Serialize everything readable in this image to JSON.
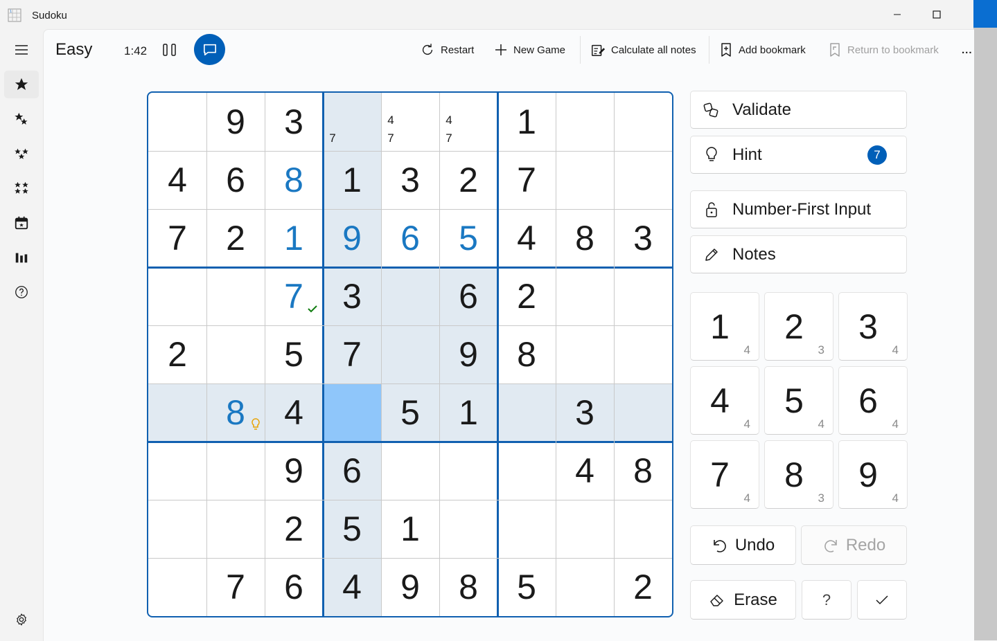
{
  "window": {
    "title": "Sudoku"
  },
  "header": {
    "difficulty": "Easy",
    "timer": "1:42"
  },
  "toolbar": {
    "restart": "Restart",
    "new_game": "New Game",
    "calculate_notes": "Calculate all notes",
    "add_bookmark": "Add bookmark",
    "return_bookmark": "Return to bookmark",
    "more": "..."
  },
  "nav": {
    "items": [
      "menu-icon",
      "star-icon",
      "two-stars-icon",
      "three-stars-icon",
      "four-stars-icon",
      "calendar-icon",
      "chart-icon",
      "help-icon"
    ],
    "settings": "gear-icon"
  },
  "board": {
    "cells": [
      [
        "",
        "9",
        "3",
        "",
        "",
        "",
        "1",
        "",
        ""
      ],
      [
        "4",
        "6",
        "8",
        "1",
        "3",
        "2",
        "7",
        "",
        ""
      ],
      [
        "7",
        "2",
        "1",
        "9",
        "6",
        "5",
        "4",
        "8",
        "3"
      ],
      [
        "",
        "",
        "7",
        "3",
        "",
        "6",
        "2",
        "",
        ""
      ],
      [
        "2",
        "",
        "5",
        "7",
        "",
        "9",
        "8",
        "",
        ""
      ],
      [
        "",
        "8",
        "4",
        "",
        "5",
        "1",
        "",
        "3",
        ""
      ],
      [
        "",
        "",
        "9",
        "6",
        "",
        "",
        "",
        "4",
        "8"
      ],
      [
        "",
        "",
        "2",
        "5",
        "1",
        "",
        "",
        "",
        ""
      ],
      [
        "",
        "7",
        "6",
        "4",
        "9",
        "8",
        "5",
        "",
        "2"
      ]
    ],
    "user_entries": [
      [
        1,
        2
      ],
      [
        2,
        2
      ],
      [
        2,
        3
      ],
      [
        2,
        4
      ],
      [
        2,
        5
      ],
      [
        3,
        2
      ],
      [
        5,
        1
      ]
    ],
    "notes": [
      {
        "row": 0,
        "col": 3,
        "values": [
          "7"
        ]
      },
      {
        "row": 0,
        "col": 4,
        "values": [
          "4",
          "7"
        ]
      },
      {
        "row": 0,
        "col": 5,
        "values": [
          "4",
          "7"
        ]
      }
    ],
    "selected": [
      5,
      3
    ],
    "checked_cell": [
      3,
      2
    ],
    "hint_cell": [
      5,
      1
    ]
  },
  "panel": {
    "validate": "Validate",
    "hint": "Hint",
    "hint_count": "7",
    "number_first": "Number-First Input",
    "notes": "Notes",
    "undo": "Undo",
    "redo": "Redo",
    "erase": "Erase",
    "question": "?",
    "numbers": [
      {
        "n": "1",
        "remaining": "4"
      },
      {
        "n": "2",
        "remaining": "3"
      },
      {
        "n": "3",
        "remaining": "4"
      },
      {
        "n": "4",
        "remaining": "4"
      },
      {
        "n": "5",
        "remaining": "4"
      },
      {
        "n": "6",
        "remaining": "4"
      },
      {
        "n": "7",
        "remaining": "4"
      },
      {
        "n": "8",
        "remaining": "3"
      },
      {
        "n": "9",
        "remaining": "4"
      }
    ]
  },
  "colors": {
    "accent": "#005fb8",
    "grid_thick": "#1060b0",
    "highlight": "#e1eaf2",
    "selected": "#8fc6fa",
    "user_digit": "#1a78c2"
  }
}
